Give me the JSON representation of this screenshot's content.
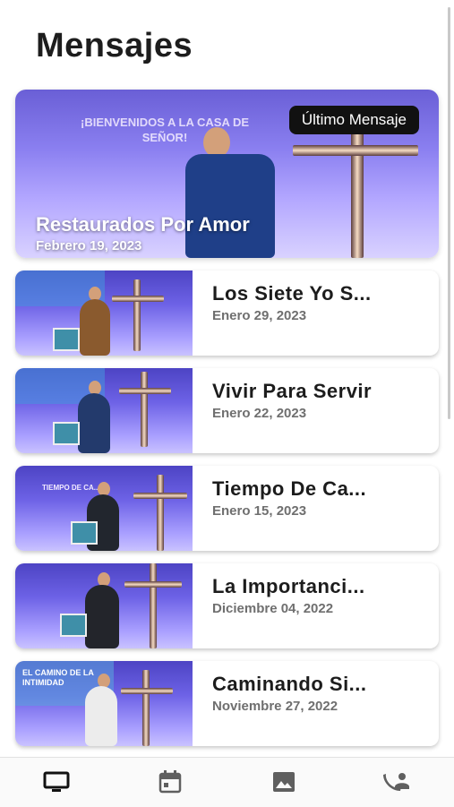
{
  "page": {
    "title": "Mensajes"
  },
  "featured": {
    "banner_line1": "¡BIENVENIDOS A LA CASA DE",
    "banner_line2": "SEÑOR!",
    "badge": "Último Mensaje",
    "title": "Restaurados Por Amor",
    "date": "Febrero 19, 2023"
  },
  "messages": [
    {
      "title": "Los Siete Yo S...",
      "date": "Enero 29, 2023"
    },
    {
      "title": "Vivir Para Servir",
      "date": "Enero 22, 2023"
    },
    {
      "title": "Tiempo De Ca...",
      "date": "Enero 15, 2023"
    },
    {
      "title": "La Importanci...",
      "date": "Diciembre 04, 2022"
    },
    {
      "title": "Caminando Si...",
      "date": "Noviembre 27, 2022"
    }
  ],
  "thumb_captions": [
    "",
    "",
    "TIEMPO DE CA...",
    "",
    "EL CAMINO DE LA INTIMIDAD"
  ],
  "nav": {
    "items": [
      {
        "icon": "monitor-icon",
        "active": true
      },
      {
        "icon": "calendar-icon",
        "active": false
      },
      {
        "icon": "image-icon",
        "active": false
      },
      {
        "icon": "contact-phone-icon",
        "active": false
      }
    ],
    "active_color": "#111111",
    "inactive_color": "#5f5f5f"
  }
}
